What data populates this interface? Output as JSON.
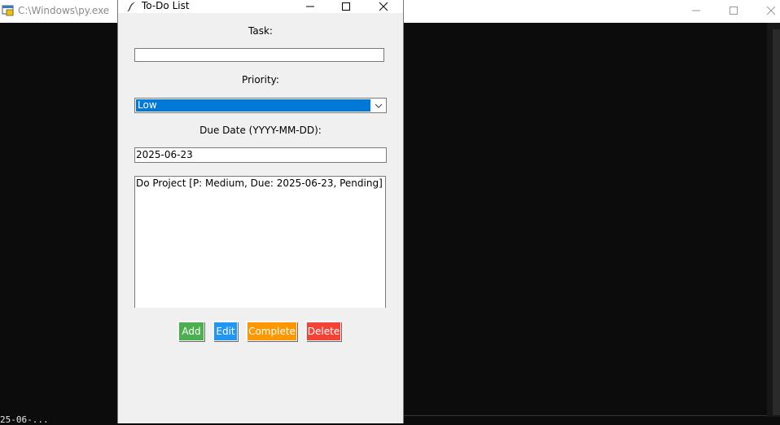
{
  "console": {
    "title": "C:\\Windows\\py.exe",
    "status_text": "25-06-..."
  },
  "app": {
    "title": "To-Do List",
    "task_label": "Task:",
    "task_value": "",
    "priority_label": "Priority:",
    "priority_value": "Low",
    "due_label": "Due Date (YYYY-MM-DD):",
    "due_value": "2025-06-23",
    "tasks": [
      "Do Project [P: Medium, Due: 2025-06-23, Pending]"
    ],
    "buttons": {
      "add": "Add",
      "edit": "Edit",
      "complete": "Complete",
      "delete": "Delete"
    },
    "colors": {
      "add": "#4caf50",
      "edit": "#2196f3",
      "complete": "#ff9800",
      "delete": "#f44336",
      "selection": "#0078d7"
    }
  }
}
